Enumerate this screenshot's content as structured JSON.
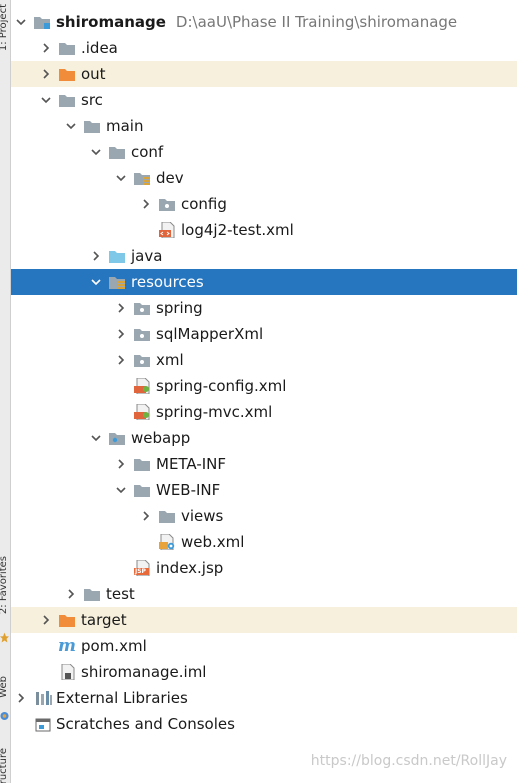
{
  "sidebar_strip": {
    "project_tab": "1: Project",
    "favorites_tab": "2: Favorites",
    "web_tab": "Web",
    "structure_tab": "Structure"
  },
  "tree": {
    "project_root": {
      "name": "shiromanage",
      "path": "D:\\aaU\\Phase II Training\\shiromanage"
    },
    "idea": ".idea",
    "out": "out",
    "src": "src",
    "main": "main",
    "conf": "conf",
    "dev": "dev",
    "config": "config",
    "log4j2": "log4j2-test.xml",
    "java": "java",
    "resources": "resources",
    "spring": "spring",
    "sqlMapperXml": "sqlMapperXml",
    "xml": "xml",
    "spring_config": "spring-config.xml",
    "spring_mvc": "spring-mvc.xml",
    "webapp": "webapp",
    "meta_inf": "META-INF",
    "web_inf": "WEB-INF",
    "views": "views",
    "web_xml": "web.xml",
    "index_jsp": "index.jsp",
    "test": "test",
    "target": "target",
    "pom": "pom.xml",
    "iml": "shiromanage.iml",
    "external_libraries": "External Libraries",
    "scratches": "Scratches and Consoles"
  },
  "file_badges": {
    "jsp": "JSP",
    "maven": "m"
  },
  "selected_item": "resources",
  "colors": {
    "selection": "#2675bf",
    "excluded_highlight": "#f7f0dd",
    "folder": "#9aa7b0",
    "excluded_folder": "#f08c3a",
    "source_folder": "#7fc8e8"
  },
  "watermark": "https://blog.csdn.net/RollJay"
}
